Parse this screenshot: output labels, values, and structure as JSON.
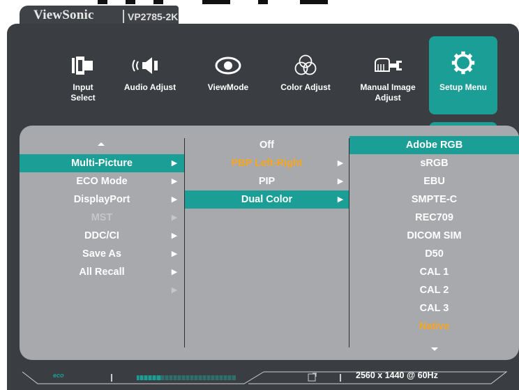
{
  "brand": {
    "name": "ViewSonic",
    "model": "VP2785-2K"
  },
  "nav": [
    {
      "id": "input-select",
      "label_line1": "Input",
      "label_line2": "Select",
      "icon": "input-select-icon"
    },
    {
      "id": "audio-adjust",
      "label_line1": "Audio Adjust",
      "label_line2": "",
      "icon": "speaker-icon"
    },
    {
      "id": "viewmode",
      "label_line1": "ViewMode",
      "label_line2": "",
      "icon": "eye-icon"
    },
    {
      "id": "color-adjust",
      "label_line1": "Color Adjust",
      "label_line2": "",
      "icon": "color-circles-icon"
    },
    {
      "id": "manual-image-adjust",
      "label_line1": "Manual Image",
      "label_line2": "Adjust",
      "icon": "hand-wrench-icon"
    },
    {
      "id": "setup-menu",
      "label_line1": "Setup Menu",
      "label_line2": "",
      "icon": "gear-icon",
      "active": true
    }
  ],
  "menu": {
    "col1": [
      "Multi-Picture",
      "ECO Mode",
      "DisplayPort",
      "MST",
      "DDC/CI",
      "Save As",
      "All Recall"
    ],
    "col2": [
      "Off",
      "PBP Left-Right",
      "PIP",
      "Dual Color"
    ],
    "col3": [
      "Adobe RGB",
      "sRGB",
      "EBU",
      "SMPTE-C",
      "REC709",
      "DICOM SIM",
      "D50",
      "CAL 1",
      "CAL 2",
      "CAL 3",
      "Native"
    ]
  },
  "status": {
    "resolution": "2560 x 1440 @ 60Hz",
    "eco_label": "eco"
  },
  "colors": {
    "accent": "#1a9e96",
    "panel": "#a7a9ac",
    "body": "#3a3d41",
    "highlight_text": "#f5a623"
  }
}
